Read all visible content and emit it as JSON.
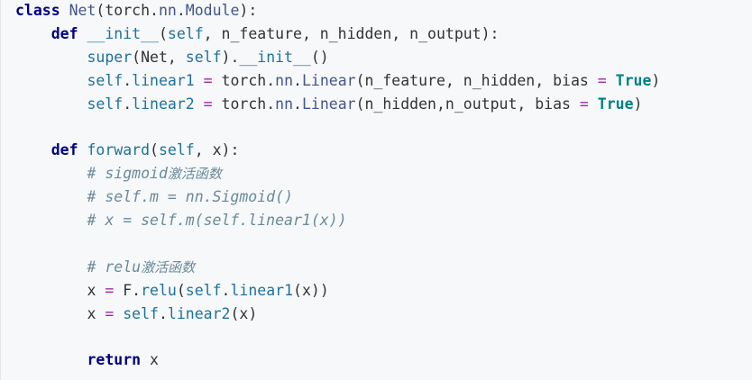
{
  "code": {
    "lines": [
      [
        [
          "kw",
          "class"
        ],
        [
          "nm",
          " "
        ],
        [
          "cls",
          "Net"
        ],
        [
          "nm",
          "(torch."
        ],
        [
          "cls",
          "nn"
        ],
        [
          "nm",
          "."
        ],
        [
          "cls",
          "Module"
        ],
        [
          "nm",
          "):"
        ]
      ],
      [
        [
          "nm",
          "    "
        ],
        [
          "kw",
          "def"
        ],
        [
          "nm",
          " "
        ],
        [
          "dun",
          "__init__"
        ],
        [
          "nm",
          "("
        ],
        [
          "self",
          "self"
        ],
        [
          "nm",
          ", n_feature, n_hidden, n_output):"
        ]
      ],
      [
        [
          "nm",
          "        "
        ],
        [
          "fn",
          "super"
        ],
        [
          "nm",
          "(Net, "
        ],
        [
          "self",
          "self"
        ],
        [
          "nm",
          ")."
        ],
        [
          "dun",
          "__init__"
        ],
        [
          "nm",
          "()"
        ]
      ],
      [
        [
          "nm",
          "        "
        ],
        [
          "self",
          "self"
        ],
        [
          "nm",
          "."
        ],
        [
          "fn",
          "linear1"
        ],
        [
          "nm",
          " "
        ],
        [
          "op",
          "="
        ],
        [
          "nm",
          " torch."
        ],
        [
          "cls",
          "nn"
        ],
        [
          "nm",
          "."
        ],
        [
          "cls",
          "Linear"
        ],
        [
          "nm",
          "(n_feature, n_hidden, bias "
        ],
        [
          "op",
          "="
        ],
        [
          "nm",
          " "
        ],
        [
          "tru",
          "True"
        ],
        [
          "nm",
          ")"
        ]
      ],
      [
        [
          "nm",
          "        "
        ],
        [
          "self",
          "self"
        ],
        [
          "nm",
          "."
        ],
        [
          "fn",
          "linear2"
        ],
        [
          "nm",
          " "
        ],
        [
          "op",
          "="
        ],
        [
          "nm",
          " torch."
        ],
        [
          "cls",
          "nn"
        ],
        [
          "nm",
          "."
        ],
        [
          "cls",
          "Linear"
        ],
        [
          "nm",
          "(n_hidden,n_output, bias "
        ],
        [
          "op",
          "="
        ],
        [
          "nm",
          " "
        ],
        [
          "tru",
          "True"
        ],
        [
          "nm",
          ")"
        ]
      ],
      [],
      [
        [
          "nm",
          "    "
        ],
        [
          "kw",
          "def"
        ],
        [
          "nm",
          " "
        ],
        [
          "fn",
          "forward"
        ],
        [
          "nm",
          "("
        ],
        [
          "self",
          "self"
        ],
        [
          "nm",
          ", x):"
        ]
      ],
      [
        [
          "nm",
          "        "
        ],
        [
          "cmt",
          "# sigmoid"
        ],
        [
          "cmt-cjk",
          "激活函数"
        ]
      ],
      [
        [
          "nm",
          "        "
        ],
        [
          "cmt",
          "# self.m = nn.Sigmoid()"
        ]
      ],
      [
        [
          "nm",
          "        "
        ],
        [
          "cmt",
          "# x = self.m(self.linear1(x))"
        ]
      ],
      [],
      [
        [
          "nm",
          "        "
        ],
        [
          "cmt",
          "# relu"
        ],
        [
          "cmt-cjk",
          "激活函数"
        ]
      ],
      [
        [
          "nm",
          "        x "
        ],
        [
          "op",
          "="
        ],
        [
          "nm",
          " F."
        ],
        [
          "fn",
          "relu"
        ],
        [
          "nm",
          "("
        ],
        [
          "self",
          "self"
        ],
        [
          "nm",
          "."
        ],
        [
          "fn",
          "linear1"
        ],
        [
          "nm",
          "(x))"
        ]
      ],
      [
        [
          "nm",
          "        x "
        ],
        [
          "op",
          "="
        ],
        [
          "nm",
          " "
        ],
        [
          "self",
          "self"
        ],
        [
          "nm",
          "."
        ],
        [
          "fn",
          "linear2"
        ],
        [
          "nm",
          "(x)"
        ]
      ],
      [],
      [
        [
          "nm",
          "        "
        ],
        [
          "kw",
          "return"
        ],
        [
          "nm",
          " x"
        ]
      ]
    ]
  },
  "colors": {
    "background": "#f6f8fa",
    "keyword": "#000080",
    "class": "#445588",
    "builtin": "#1f7199",
    "operator": "#a626a4",
    "boolean": "#008080",
    "comment": "#6a8a9a"
  }
}
